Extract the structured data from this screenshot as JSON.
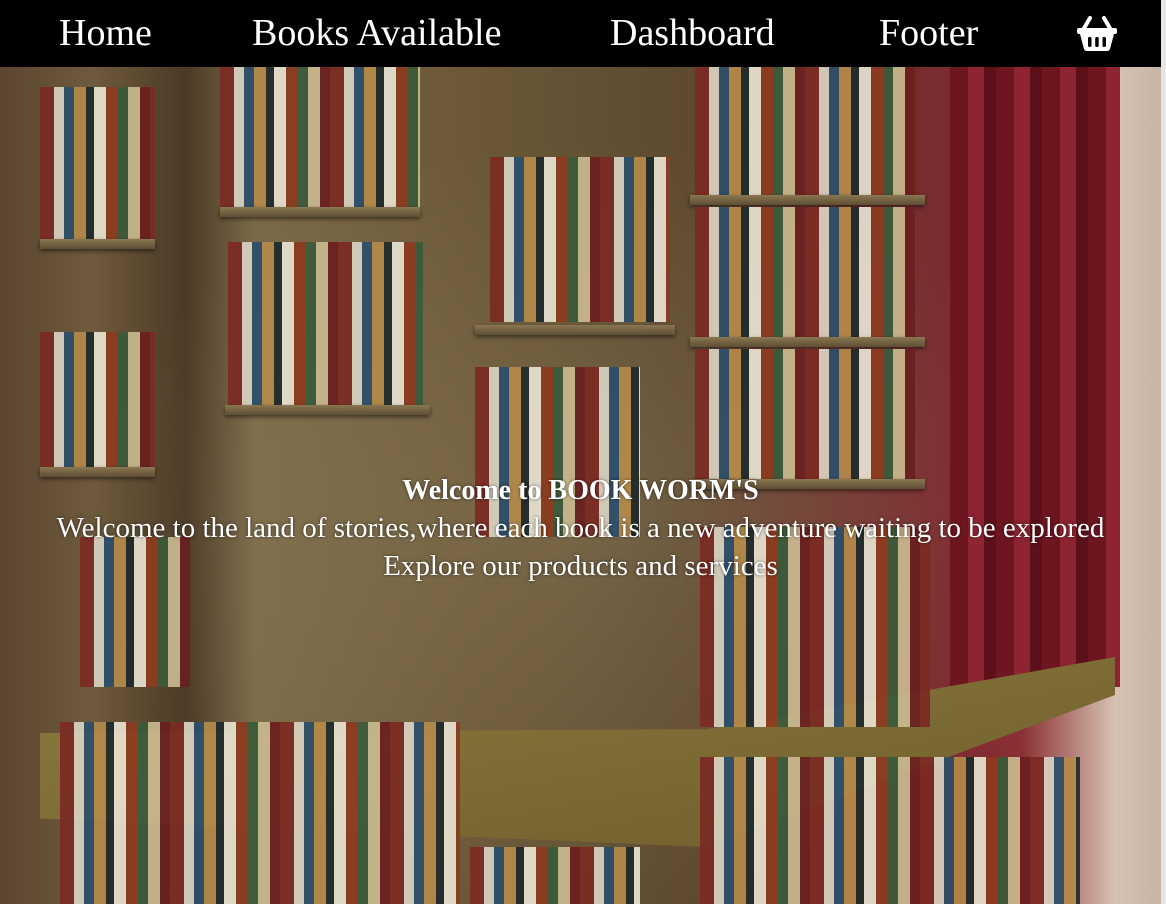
{
  "navbar": {
    "items": [
      {
        "label": "Home"
      },
      {
        "label": "Books Available"
      },
      {
        "label": "Dashboard"
      },
      {
        "label": "Footer"
      }
    ],
    "cart_icon": "shopping-basket-icon",
    "background": "#000000",
    "text_color": "#ffffff"
  },
  "hero": {
    "title": "Welcome to BOOK WORM'S",
    "subtitle": "Welcome to the land of stories,where each book is a new adventure waiting to be explored",
    "cta_text": "Explore our products and services",
    "background_image": "bookstore-shelves-photo"
  }
}
